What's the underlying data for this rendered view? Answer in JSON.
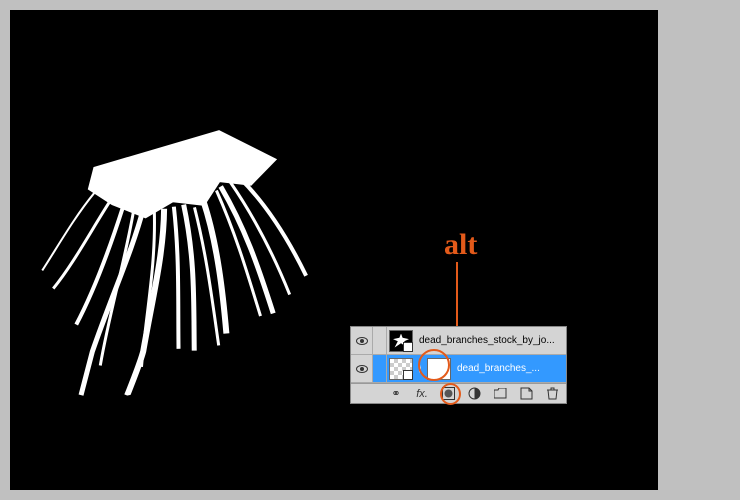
{
  "annotation": {
    "label": "alt"
  },
  "layers_panel": {
    "rows": [
      {
        "name": "dead_branches_stock_by_jo...",
        "selected": false,
        "has_mask": false
      },
      {
        "name": "dead_branches_...",
        "selected": true,
        "has_mask": true
      }
    ],
    "footer_icons": {
      "link": "⚭",
      "fx": "fx.",
      "mask": "◐",
      "adjust": "◑",
      "group": "▭",
      "new": "▫",
      "trash": "🗑"
    }
  }
}
